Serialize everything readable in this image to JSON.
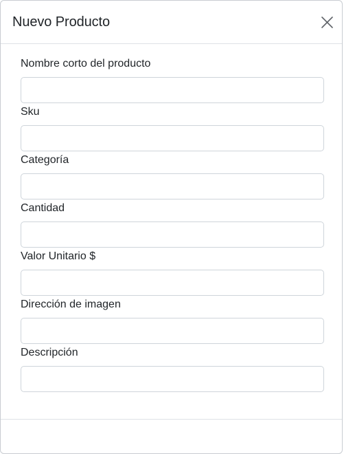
{
  "modal": {
    "title": "Nuevo Producto",
    "close_icon": "close-icon"
  },
  "form": {
    "fields": [
      {
        "id": "nombre",
        "label": "Nombre corto del producto",
        "value": "",
        "placeholder": ""
      },
      {
        "id": "sku",
        "label": "Sku",
        "value": "",
        "placeholder": ""
      },
      {
        "id": "categoria",
        "label": "Categoría",
        "value": "",
        "placeholder": ""
      },
      {
        "id": "cantidad",
        "label": "Cantidad",
        "value": "",
        "placeholder": ""
      },
      {
        "id": "valor",
        "label": "Valor Unitario $",
        "value": "",
        "placeholder": ""
      },
      {
        "id": "imagen",
        "label": "Dirección de imagen",
        "value": "",
        "placeholder": ""
      },
      {
        "id": "descripcion",
        "label": "Descripción",
        "value": "",
        "placeholder": ""
      }
    ]
  },
  "colors": {
    "text": "#212529",
    "border": "#ced4da",
    "divider": "#dee2e6",
    "background_accent": "#1f3f8f"
  }
}
